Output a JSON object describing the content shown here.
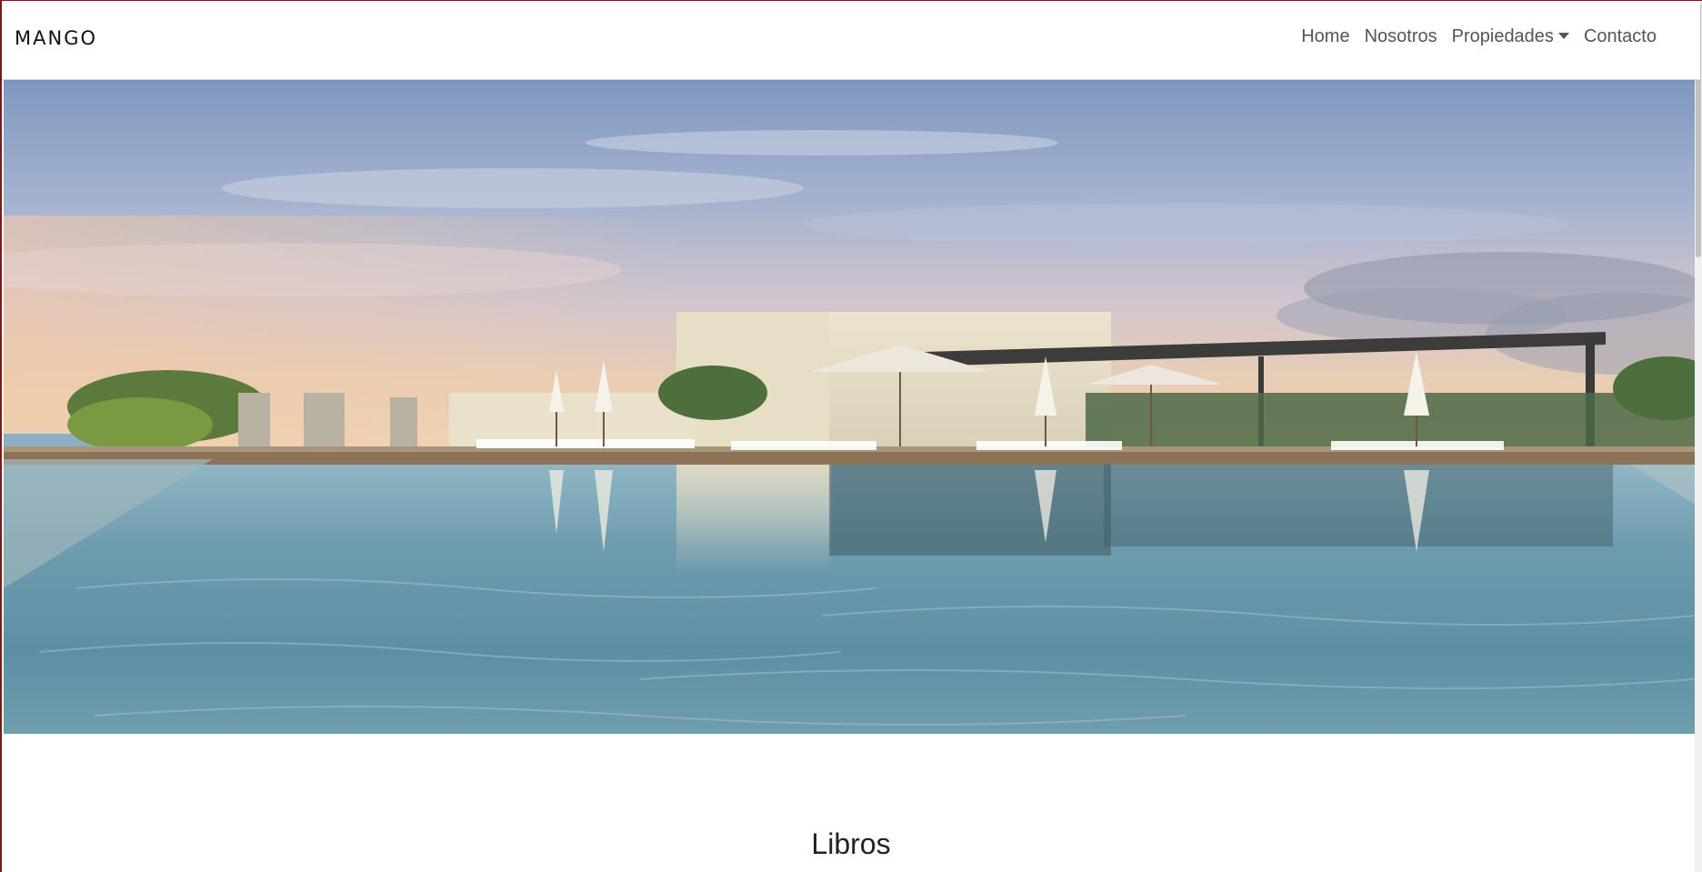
{
  "navbar": {
    "brand": "MANGO",
    "links": {
      "home": "Home",
      "nosotros": "Nosotros",
      "propiedades": "Propiedades",
      "contacto": "Contacto"
    }
  },
  "hero": {
    "alt": "Rooftop infinity pool with loungers, umbrellas and cabanas at sunset"
  },
  "section": {
    "title": "Libros"
  },
  "colors": {
    "nav_text": "#555555",
    "brand_text": "#111111",
    "frame_border": "#7a1a1a"
  }
}
